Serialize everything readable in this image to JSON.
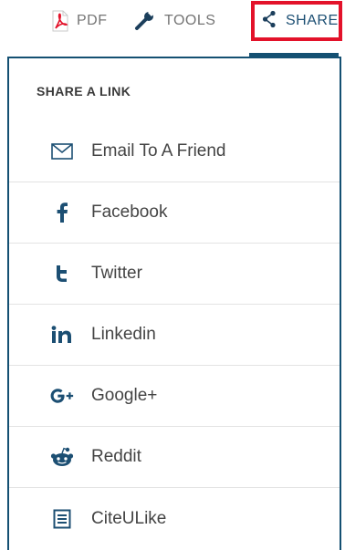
{
  "toolbar": {
    "pdf_label": "PDF",
    "tools_label": "TOOLS",
    "share_label": "SHARE"
  },
  "share_menu": {
    "title": "SHARE A LINK",
    "items": [
      {
        "label": "Email To A Friend",
        "icon": "email-icon"
      },
      {
        "label": "Facebook",
        "icon": "facebook-icon"
      },
      {
        "label": "Twitter",
        "icon": "twitter-icon"
      },
      {
        "label": "Linkedin",
        "icon": "linkedin-icon"
      },
      {
        "label": "Google+",
        "icon": "google-plus-icon"
      },
      {
        "label": "Reddit",
        "icon": "reddit-icon"
      },
      {
        "label": "CiteULike",
        "icon": "citeulike-icon"
      }
    ]
  },
  "colors": {
    "accent": "#145072",
    "highlight": "#e3122a",
    "pdf_icon": "#e3122a"
  }
}
